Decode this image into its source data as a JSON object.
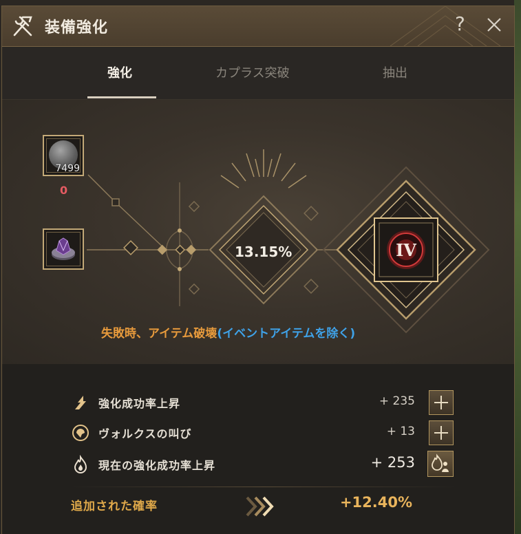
{
  "window": {
    "title": "装備強化",
    "help_label": "?",
    "close_icon": "close-icon"
  },
  "tabs": [
    {
      "label": "強化",
      "active": true
    },
    {
      "label": "カプラス突破",
      "active": false
    },
    {
      "label": "抽出",
      "active": false
    }
  ],
  "enhance": {
    "material_count": "7499",
    "failstack": "0",
    "success_rate": "13.15%",
    "target_level": "IV",
    "warning_prefix": "失敗時、アイテム破壊",
    "warning_suffix": "(イベントアイテムを除く)"
  },
  "stats": [
    {
      "icon": "arrow-up-icon",
      "label": "強化成功率上昇",
      "value": "+ 235",
      "action": "plus"
    },
    {
      "icon": "valks-cry-icon",
      "label": "ヴォルクスの叫び",
      "value": "+ 13",
      "action": "plus"
    },
    {
      "icon": "flame-icon",
      "label": "現在の強化成功率上昇",
      "value": "+ 253",
      "action": "family"
    }
  ],
  "added": {
    "label": "追加された確率",
    "value": "+12.40%"
  },
  "colors": {
    "accent_gold": "#c3a977",
    "warning_orange": "#e79a3c",
    "warning_blue": "#3fa2e8",
    "failstack_red": "#e45b62"
  }
}
